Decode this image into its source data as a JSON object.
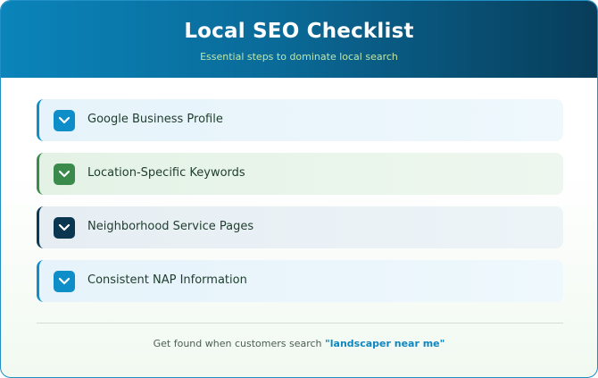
{
  "header": {
    "title": "Local SEO Checklist",
    "subtitle": "Essential steps to dominate local search"
  },
  "checklist": {
    "items": [
      {
        "label": "Google Business Profile",
        "accent": "#0f8fc6",
        "icon": "chevron-down-icon"
      },
      {
        "label": "Location-Specific Keywords",
        "accent": "#3a8c4d",
        "icon": "chevron-down-icon"
      },
      {
        "label": "Neighborhood Service Pages",
        "accent": "#0b3a55",
        "icon": "chevron-down-icon"
      },
      {
        "label": "Consistent NAP Information",
        "accent": "#0f8fc6",
        "icon": "chevron-down-icon"
      }
    ]
  },
  "footer": {
    "text": "Get found when customers search",
    "highlight": "\"landscaper near me\""
  },
  "colors": {
    "header_start": "#0a84ba",
    "header_end": "#083d5a",
    "subtitle": "#bfe6a7",
    "highlight": "#0e86bf"
  }
}
